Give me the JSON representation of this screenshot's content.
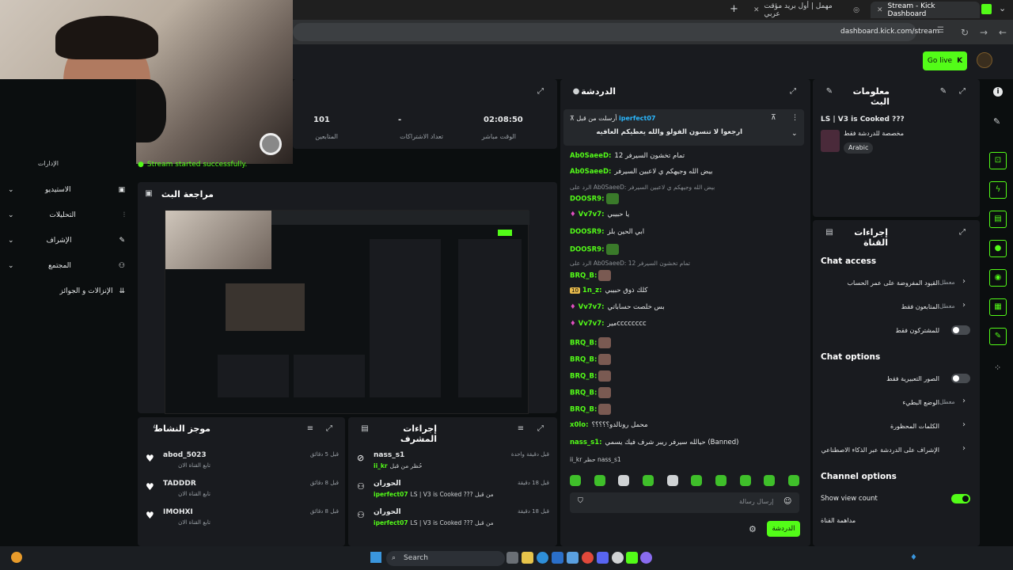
{
  "browser": {
    "tabs": [
      {
        "title": "Stream - Kick Dashboard",
        "active": true
      },
      {
        "title": "مهمل | أول بريد مؤقت عربي",
        "active": false
      }
    ],
    "url": "dashboard.kick.com/stream",
    "new_tab": "+"
  },
  "header": {
    "go_live_label": "Go live"
  },
  "sidebar": {
    "items": [
      {
        "label": "الإدارات"
      },
      {
        "label": "الاستيديو"
      },
      {
        "label": "التحليلات"
      },
      {
        "label": "الإشراف"
      },
      {
        "label": "المجتمع"
      },
      {
        "label": "الإنزالات و الجوائز"
      }
    ],
    "toast": "Stream started successfully."
  },
  "stats": {
    "time_value": "02:08:50",
    "time_label": "الوقت مباشر",
    "subs_value": "-",
    "subs_label": "تعداد الاشتراكات",
    "viewers_value": "101",
    "viewers_label": "المتابعين"
  },
  "preview": {
    "title": "مراجعة البث"
  },
  "activity": {
    "title": "موجز النشاط",
    "items": [
      {
        "name": "abod_5023",
        "sub": "تابع القناة الان",
        "time": "قبل 5 دقائق"
      },
      {
        "name": "TADDDR",
        "sub": "تابع القناة الان",
        "time": "قبل 8 دقائق"
      },
      {
        "name": "IMOHXI",
        "sub": "تابع القناة الان",
        "time": "قبل 8 دقائق"
      }
    ]
  },
  "modactions": {
    "title": "إجراءات المشرف",
    "items": [
      {
        "name": "nass_s1",
        "sub_prefix": "حُظر من قبل",
        "by": "ii_kr",
        "time": "قبل دقيقة واحدة"
      },
      {
        "name": "الحوران",
        "sub_prefix": "LS | V3 is Cooked ??? من قبل",
        "by": "iperfect07",
        "time": "قبل 18 دقيقة"
      },
      {
        "name": "الحوران",
        "sub_prefix": "LS | V3 is Cooked ??? من قبل",
        "by": "iperfect07",
        "time": "قبل 18 دقيقة"
      }
    ]
  },
  "chat": {
    "title": "الدردشة",
    "pinned_by_prefix": "أرسلت من قبل",
    "pinned_by": "iperfect07",
    "pinned_text": "ارجعوا لا تنسون الفولو والله يعطيكم العافيه",
    "messages": [
      {
        "user": "Ab0SaeeD:",
        "text": "تمام تخشون السيرفر 12"
      },
      {
        "user": "Ab0SaeeD:",
        "text": "بيض الله وجيهكم ي لاعبين السيرفر"
      },
      {
        "user": "",
        "text": "الرد على Ab0SaeeD: بيض الله وجيهكم ي لاعبين السيرفر",
        "reply": true
      },
      {
        "user": "DOOSR9:",
        "text": "",
        "emote": true
      },
      {
        "user": "Vv7v7:",
        "text": "يا حبيبي"
      },
      {
        "user": "DOOSR9:",
        "text": "ابي الحين بلز"
      },
      {
        "user": "DOOSR9:",
        "text": "",
        "emote": true
      },
      {
        "user": "",
        "text": "الرد على Ab0SaeeD: تمام تخشون السيرفر 12",
        "reply": true
      },
      {
        "user": "BRQ_B:",
        "text": "",
        "face": true
      },
      {
        "user": "1n_z:",
        "text": "كلك ذوق حبيبي",
        "badge": "10"
      },
      {
        "user": "Vv7v7:",
        "text": "بس خلصت حساباتي"
      },
      {
        "user": "Vv7v7:",
        "text": "ميرcccccccc"
      },
      {
        "user": "BRQ_B:",
        "text": "",
        "face": true
      },
      {
        "user": "BRQ_B:",
        "text": "",
        "face": true
      },
      {
        "user": "BRQ_B:",
        "text": "",
        "face": true
      },
      {
        "user": "BRQ_B:",
        "text": "",
        "face": true
      },
      {
        "user": "BRQ_B:",
        "text": "",
        "face": true
      },
      {
        "user": "x0lo:",
        "text": "محمل رونالدو؟؟؟؟؟"
      },
      {
        "user": "nass_s1:",
        "text": "حيالله سيرفر ريبر شرف فيك يسمي (Banned)"
      },
      {
        "user": "",
        "text": "ii_kr حظر nass_s1",
        "reply": true
      }
    ],
    "input_placeholder": "إرسال رسالة",
    "send_label": "الدردشة"
  },
  "streaminfo": {
    "title": "معلومات البث",
    "stream_title": "LS | V3 is Cooked ???",
    "category": "مخصصة للدردشة فقط",
    "language": "Arabic"
  },
  "channelactions": {
    "title": "إجراءات القناة",
    "chat_access": "Chat access",
    "rows1": [
      {
        "label": "القيود المفروضة على عمر الحساب",
        "value": "معطل"
      },
      {
        "label": "المتابعون فقط",
        "value": "معطل"
      },
      {
        "label": "للمشتركون فقط",
        "value": ""
      }
    ],
    "chat_options": "Chat options",
    "rows2": [
      {
        "label": "الصور التعبيرية فقط",
        "value": ""
      },
      {
        "label": "الوضع البطيء",
        "value": "معطل"
      },
      {
        "label": "الكلمات المحظورة",
        "value": ""
      },
      {
        "label": "الإشراف على الدردشة عبر الذكاء الاصطناعي",
        "value": ""
      }
    ],
    "channel_options": "Channel options",
    "show_view_count": "Show view count",
    "host_label": "مداهمة القناة"
  },
  "taskbar": {
    "search_placeholder": "Search"
  },
  "colors": {
    "accent": "#53fc18",
    "panel": "#191b1f",
    "bg": "#0b0e0f"
  }
}
